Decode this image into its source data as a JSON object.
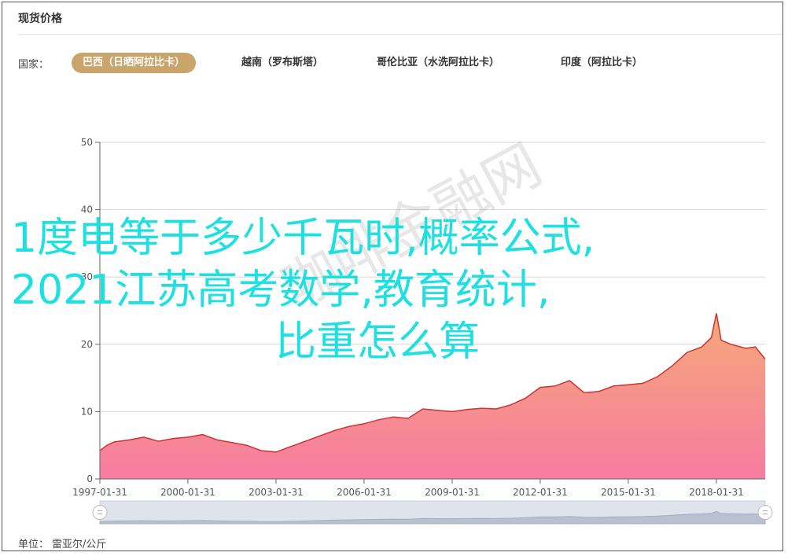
{
  "header": {
    "title": "现货价格"
  },
  "tabs_label": "国家：",
  "tabs": [
    {
      "label": "巴西（日晒阿拉比卡）",
      "active": true
    },
    {
      "label": "越南（罗布斯塔）",
      "active": false
    },
    {
      "label": "哥伦比亚（水洗阿拉比卡）",
      "active": false
    },
    {
      "label": "印度（阿拉比卡）",
      "active": false
    }
  ],
  "overlay": {
    "line1": "1度电等于多少千瓦时,概率公式,",
    "line2": "2021江苏高考数学,教育统计,",
    "line3": "比重怎么算"
  },
  "watermark": "咖啡金融网",
  "unit": {
    "label": "单位：",
    "value": "雷亚尔/公斤"
  },
  "colors": {
    "accent": "#c9a46b",
    "line": "#cc3333",
    "area_top": "#f5a97a",
    "area_bottom": "#f77ba0",
    "overlay_text": "#1fe0e0"
  },
  "icons": {
    "slider_handle": "handle-icon"
  },
  "chart_data": {
    "type": "area",
    "ylim": [
      0,
      50
    ],
    "yticks": [
      0,
      10,
      20,
      30,
      40,
      50
    ],
    "xlim": [
      "1997-01-31",
      "2019-09-30"
    ],
    "xticks": [
      "1997-01-31",
      "2000-01-31",
      "2003-01-31",
      "2006-01-31",
      "2009-01-31",
      "2012-01-31",
      "2015-01-31",
      "2018-01-31"
    ],
    "grid": true,
    "series": [
      {
        "x": [
          "1997-01-31",
          "1997-04-30",
          "1997-07-31",
          "1998-01-31",
          "1998-07-31",
          "1999-01-31",
          "1999-07-31",
          "2000-01-31",
          "2000-07-31",
          "2001-01-31",
          "2001-07-31",
          "2002-01-31",
          "2002-07-31",
          "2003-01-31",
          "2003-07-31",
          "2004-01-31",
          "2004-07-31",
          "2005-01-31",
          "2005-07-31",
          "2006-01-31",
          "2006-07-31",
          "2007-01-31",
          "2007-07-31",
          "2008-01-31",
          "2008-07-31",
          "2009-01-31",
          "2009-07-31",
          "2010-01-31",
          "2010-07-31",
          "2011-01-31",
          "2011-07-31",
          "2012-01-31",
          "2012-07-31",
          "2013-01-31",
          "2013-07-31",
          "2014-01-31",
          "2014-07-31",
          "2015-01-31",
          "2015-07-31",
          "2016-01-31",
          "2016-07-31",
          "2017-01-31",
          "2017-07-31",
          "2017-11-30",
          "2018-01-31",
          "2018-03-31",
          "2018-07-31",
          "2019-01-31",
          "2019-05-31",
          "2019-09-30"
        ],
        "values": [
          4.2,
          5.0,
          5.5,
          5.8,
          6.2,
          5.6,
          6.0,
          6.2,
          6.6,
          5.8,
          5.4,
          5.0,
          4.2,
          4.0,
          4.8,
          5.6,
          6.4,
          7.2,
          7.8,
          8.2,
          8.8,
          9.2,
          9.0,
          10.4,
          10.2,
          10.0,
          10.3,
          10.5,
          10.4,
          11.0,
          12.0,
          13.6,
          13.8,
          14.6,
          12.8,
          13.0,
          13.8,
          14.0,
          14.2,
          15.2,
          16.8,
          18.8,
          19.6,
          21.0,
          24.6,
          20.6,
          20.0,
          19.4,
          19.6,
          17.8
        ]
      }
    ]
  }
}
